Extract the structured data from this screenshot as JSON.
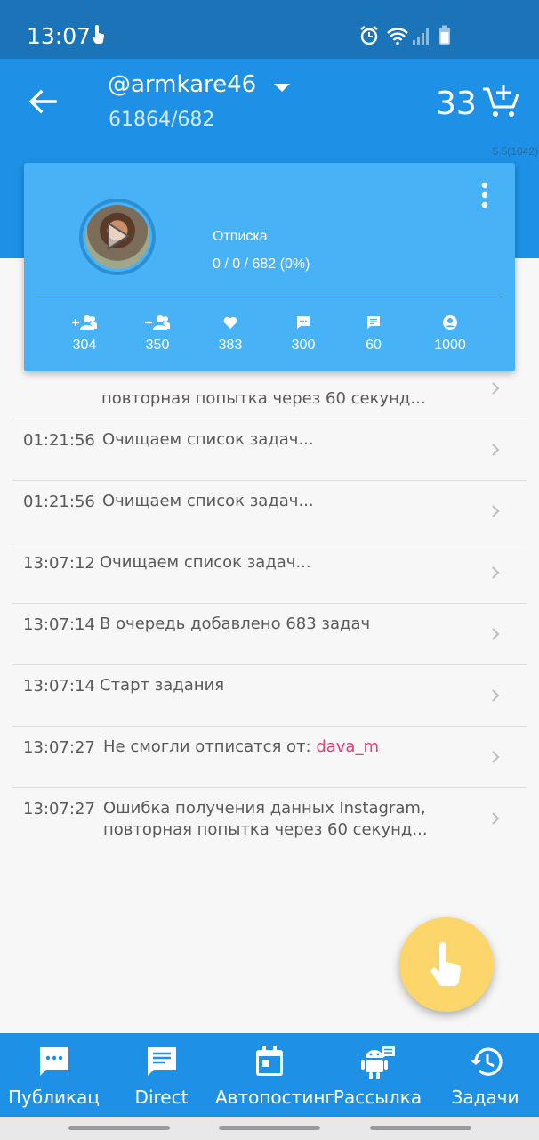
{
  "status_bar": {
    "time": "13:07"
  },
  "app_bar": {
    "account_name": "@armkare46",
    "account_stats": "61864/682",
    "balance": "33"
  },
  "version": "5.5(1042)",
  "task_card": {
    "title": "Отписка",
    "progress": "0 / 0 / 682 (0%)",
    "stats": [
      {
        "icon": "add-user-icon",
        "value": "304"
      },
      {
        "icon": "remove-user-icon",
        "value": "350"
      },
      {
        "icon": "heart-icon",
        "value": "383"
      },
      {
        "icon": "comment-icon",
        "value": "300"
      },
      {
        "icon": "message-icon",
        "value": "60"
      },
      {
        "icon": "account-circle-icon",
        "value": "1000"
      }
    ]
  },
  "log": [
    {
      "time": "",
      "line1": "",
      "line2": "повторная попытка через 60 секунд..."
    },
    {
      "time": "01:21:56",
      "line1": "Очищаем список задач...",
      "line2": ""
    },
    {
      "time": "01:21:56",
      "line1": "Очищаем список задач...",
      "line2": ""
    },
    {
      "time": "13:07:12",
      "line1": "Очищаем список задач...",
      "line2": ""
    },
    {
      "time": "13:07:14",
      "line1": "В очередь добавлено 683 задач",
      "line2": ""
    },
    {
      "time": "13:07:14",
      "line1": "Старт задания",
      "line2": ""
    },
    {
      "time": "13:07:27",
      "line1": "Не смогли отписатся от:",
      "link": "dava_m",
      "line2": ""
    },
    {
      "time": "13:07:27",
      "line1": "Ошибка получения данных Instagram,",
      "line2": "повторная попытка через 60 секунд..."
    }
  ],
  "bottom_nav": [
    {
      "icon": "comment-icon",
      "label": "Публикац"
    },
    {
      "icon": "message-icon",
      "label": "Direct"
    },
    {
      "icon": "calendar-icon",
      "label": "Автопостинг"
    },
    {
      "icon": "android-bot-icon",
      "label": "Рассылка"
    },
    {
      "icon": "history-icon",
      "label": "Задачи"
    }
  ],
  "colors": {
    "primary": "#1e90e6",
    "card": "#48b2f6",
    "status_bar": "#1c74b8",
    "fab": "#fcd66a",
    "link": "#e0407a"
  }
}
